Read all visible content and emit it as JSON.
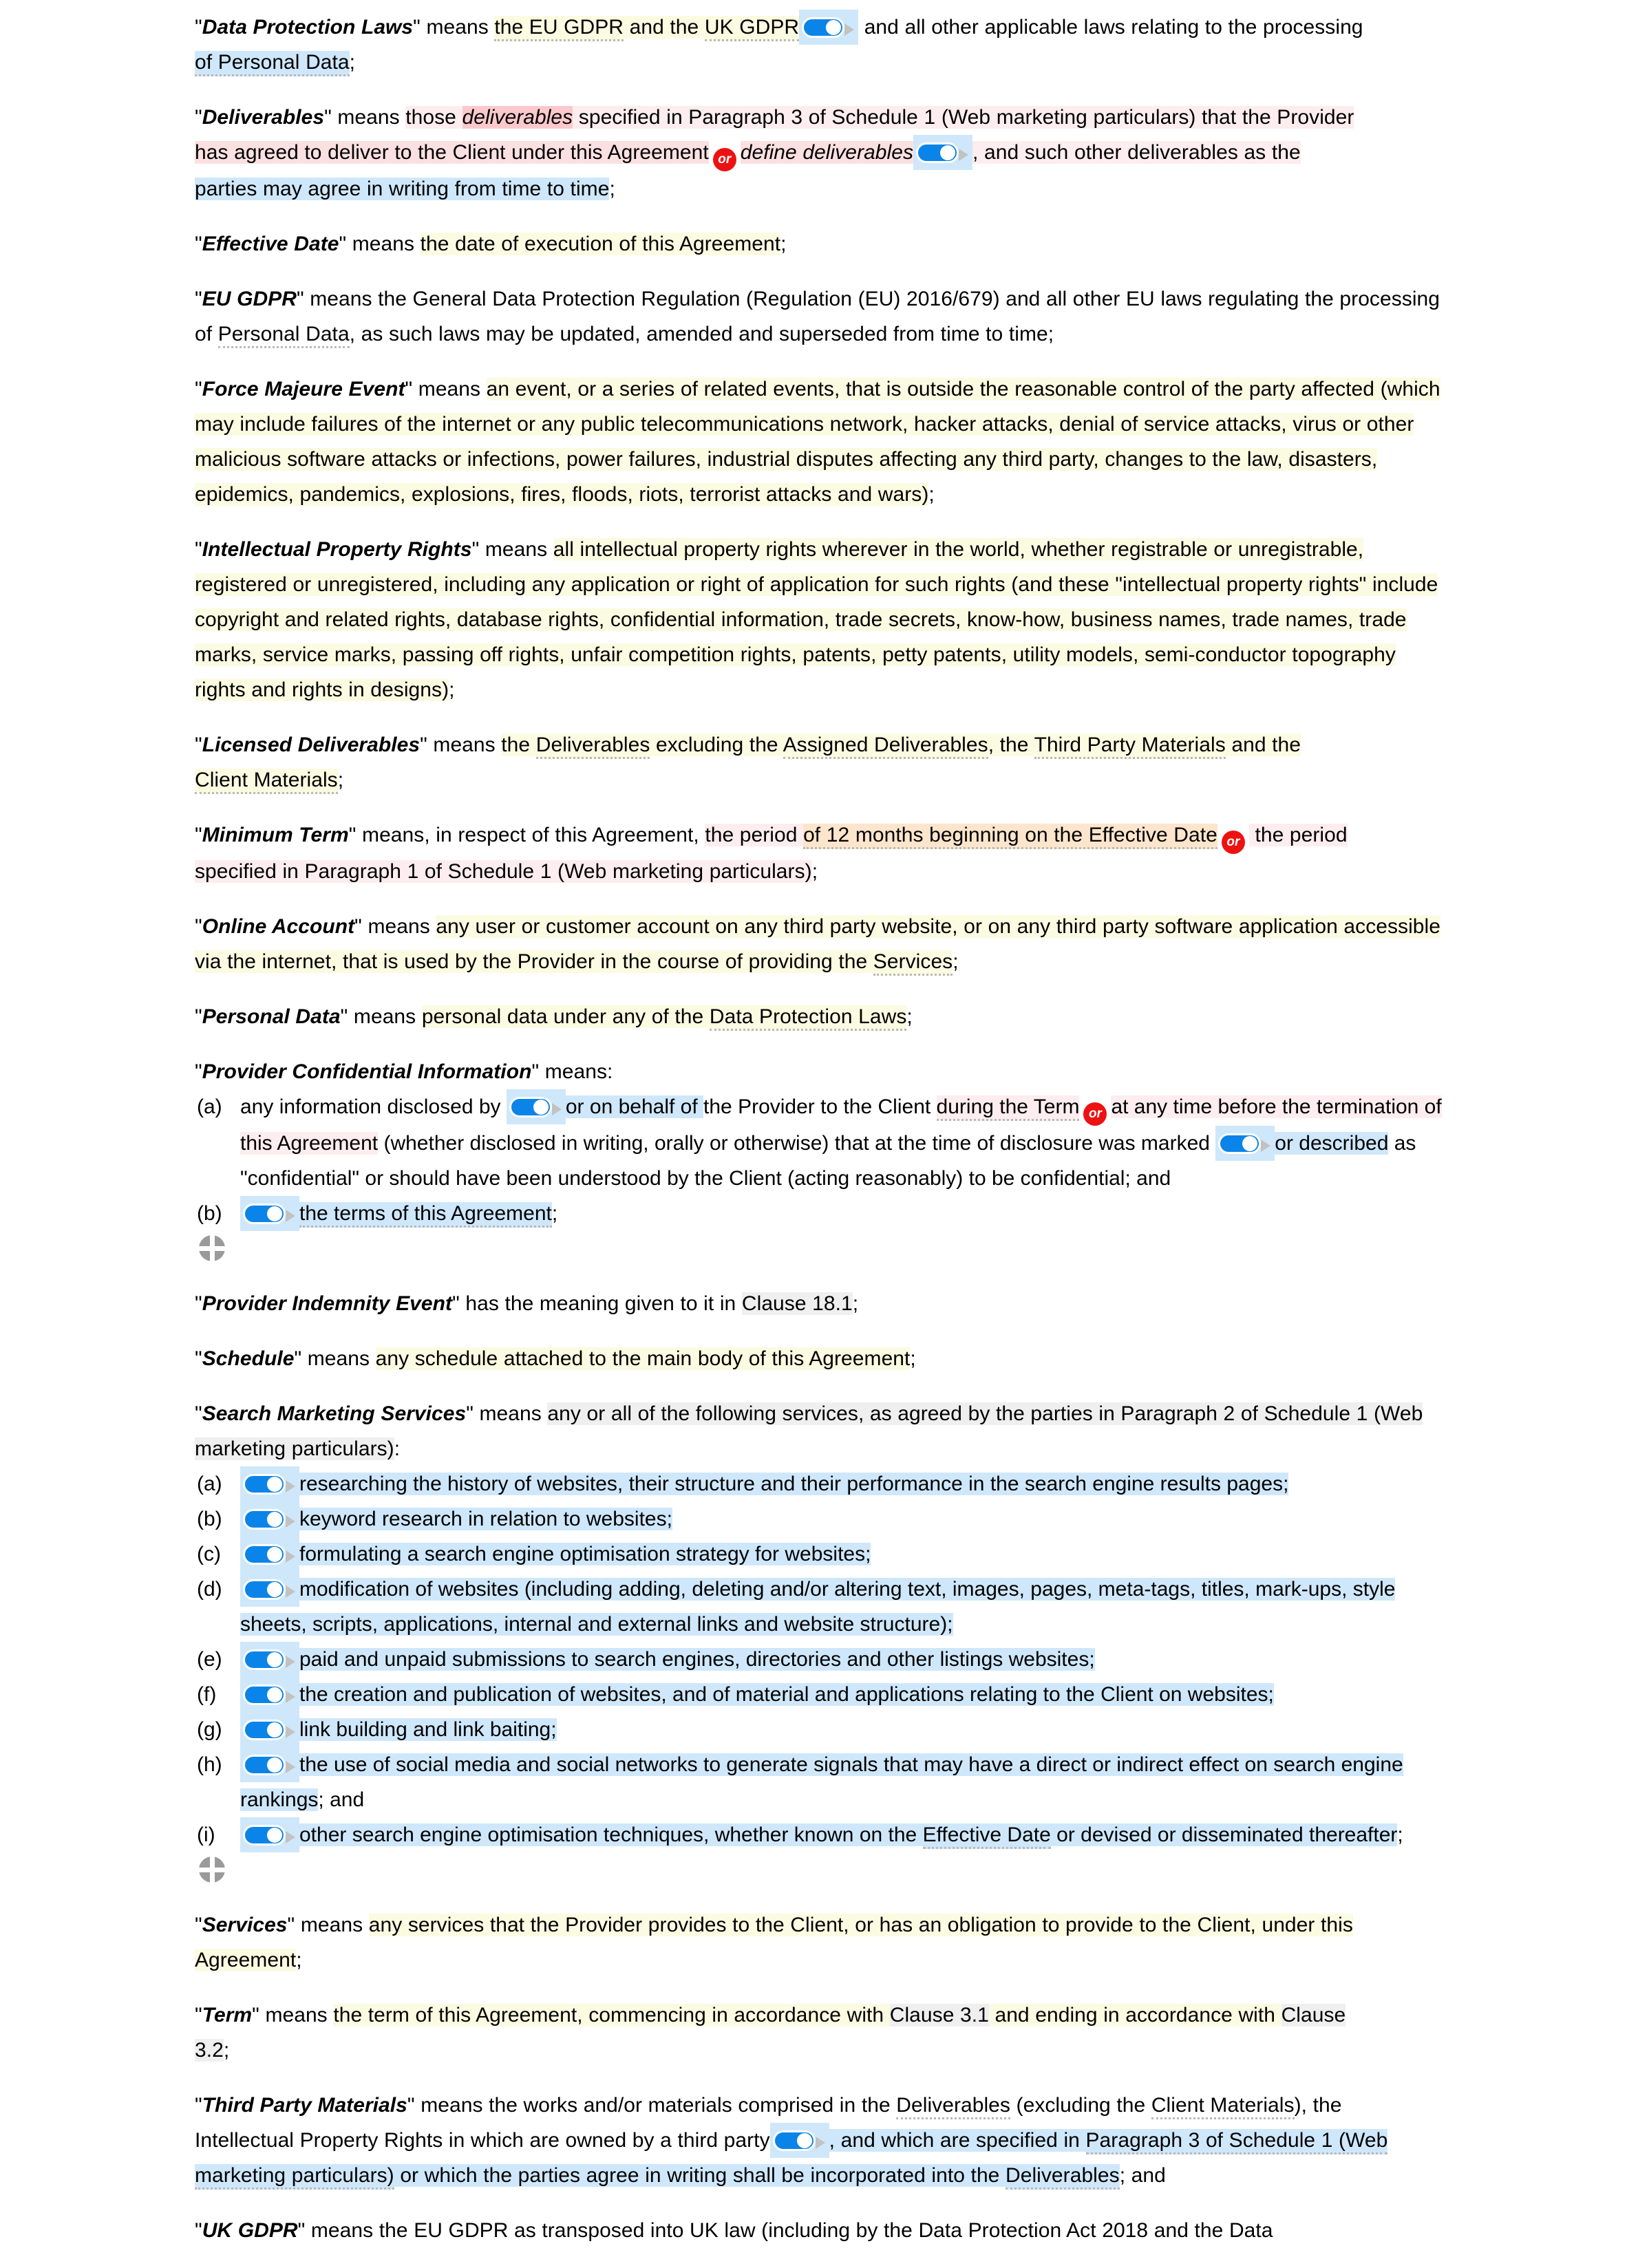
{
  "document": {
    "type": "legal-contract-definitions",
    "icons": {
      "or_badge": "or-badge-icon",
      "toggle": "toggle-switch-icon",
      "move_handle": "move-crosshair-icon"
    },
    "colors": {
      "or_badge_bg": "#ee1111",
      "or_badge_text": "#ffffff",
      "toggle_on": "#0a84e8",
      "toggle_knob": "#ffffff",
      "toggle_arrow": "#c2c2c2",
      "move_handle": "#9a9a9a",
      "highlight_yellow": "#fbfbe2",
      "highlight_blue": "#cfe7fa",
      "highlight_pink": "#fbe0e2",
      "highlight_pink_strong": "#fbc9cc",
      "highlight_pink_light": "#fdedee",
      "highlight_peach": "#fde5cc",
      "highlight_grey": "#efefef",
      "text": "#000000"
    },
    "labels": {
      "or": "or"
    }
  },
  "definitions": {
    "data_protection_laws": {
      "term": "Data Protection Laws",
      "p1": "\" means ",
      "s_eu_gdpr": "the EU GDPR",
      "s_and_the": " and the ",
      "s_uk_gdpr": "UK GDPR",
      "s_rest": " and all other applicable laws relating to the processing",
      "s_line2": "of Personal Data",
      "s_end": ";"
    },
    "deliverables": {
      "term": "Deliverables",
      "p1": "\" means ",
      "s_those": "those ",
      "s_deliverables_italic": "deliverables",
      "s_specified": " specified in Paragraph 3 of Schedule 1 (Web marketing particulars) that the Provider",
      "s_line2": "has agreed to deliver to the Client under this Agreement",
      "s_define_italic": "define deliverables",
      "s_after": ", and such other deliverables as the",
      "s_line3": "parties may agree in writing from time to time",
      "s_end": ";"
    },
    "effective_date": {
      "term": "Effective Date",
      "p1": "\" means ",
      "s_body": "the date of execution of this Agreement",
      "s_end": ";"
    },
    "eu_gdpr": {
      "term": "EU GDPR",
      "p1": "\" means the General Data Protection Regulation (Regulation (EU) 2016/679) and all other EU laws regulating the",
      "p2": "processing of ",
      "s_personal_data": "Personal Data",
      "p3": ", as such laws may be updated, amended and superseded from time to time;"
    },
    "force_majeure": {
      "term": "Force Majeure Event",
      "p1": "\" means ",
      "s_body": "an event, or a series of related events, that is outside the reasonable control of the party affected (which may include failures of the internet or any public telecommunications network, hacker attacks, denial of service attacks, virus or other malicious software attacks or infections, power failures, industrial disputes affecting any third party, changes to the law, disasters, epidemics, pandemics, explosions, fires, floods, riots, terrorist attacks and wars)",
      "s_end": ";"
    },
    "ip_rights": {
      "term": "Intellectual Property Rights",
      "p1": "\" means ",
      "s_body": "all intellectual property rights wherever in the world, whether registrable or unregistrable, registered or unregistered, including any application or right of application for such rights (and these \"intellectual property rights\" include copyright and related rights, database rights, confidential information, trade secrets, know-how, business names, trade names, trade marks, service marks, passing off rights, unfair competition rights, patents, petty patents, utility models, semi-conductor topography rights and rights in designs)",
      "s_end": ";"
    },
    "licensed_deliverables": {
      "term": "Licensed Deliverables",
      "p1": "\" means ",
      "s_a": "the ",
      "s_deliverables": "Deliverables",
      "s_b": " excluding the ",
      "s_assigned": "Assigned Deliverables",
      "s_c": ", the ",
      "s_third_party": "Third Party Materials",
      "s_d": " and the",
      "s_line2": "Client Materials",
      "s_end": ";"
    },
    "minimum_term": {
      "term": "Minimum Term",
      "p1": "\" means, in respect of this Agreement, ",
      "s_period": "the period ",
      "s_12months": "of 12 months beginning on the Effective Date",
      "s_after_or": " the period",
      "s_line2": "specified in Paragraph 1 of Schedule 1 (Web marketing particulars)",
      "s_end": ";"
    },
    "online_account": {
      "term": "Online Account",
      "p1": "\" means ",
      "s_body": "any user or customer account on any third party website, or on any third party software application accessible via the internet, that is used by the Provider in the course of providing the ",
      "s_services": "Services",
      "s_end": ";"
    },
    "personal_data": {
      "term": "Personal Data",
      "p1": "\" means ",
      "s_body": "personal data under any of the ",
      "s_dpl": "Data Protection Laws",
      "s_end": ";"
    },
    "provider_confidential": {
      "term": "Provider Confidential Information",
      "p1": "\" means:",
      "items": [
        {
          "marker": "(a)",
          "pre": "any information disclosed by ",
          "mid1": "or on behalf of ",
          "mid2": "the Provider to the Client ",
          "during_term": "during the Term",
          "after_or": "at any time before the termination of this Agreement",
          "tail1": " (whether disclosed in writing, orally or otherwise) that at the time of disclosure was marked ",
          "described": "or described",
          "tail2": " as \"confidential\" or should have been understood by the Client (acting reasonably) to be confidential; and"
        },
        {
          "marker": "(b)",
          "text": "the terms of this Agreement",
          "end": ";"
        }
      ]
    },
    "provider_indemnity": {
      "term": "Provider Indemnity Event",
      "p1": "\" has the meaning given to it in ",
      "s_clause": "Clause 18.1",
      "s_end": ";"
    },
    "schedule": {
      "term": "Schedule",
      "p1": "\" means ",
      "s_body": "any schedule attached to the main body of this Agreement",
      "s_end": ";"
    },
    "search_marketing": {
      "term": "Search Marketing Services",
      "p1": "\" means ",
      "s_body": "any or all of the following services, as agreed by the parties in ",
      "s_para": "Paragraph 2 of Schedule 1 (Web marketing particulars)",
      "s_end": ":",
      "items": [
        {
          "marker": "(a)",
          "text": "researching the history of websites, their structure and their performance in the search engine results pages;"
        },
        {
          "marker": "(b)",
          "text": "keyword research in relation to websites;"
        },
        {
          "marker": "(c)",
          "text": "formulating a search engine optimisation strategy for websites;"
        },
        {
          "marker": "(d)",
          "text": "modification of websites (including adding, deleting and/or altering text, images, pages, meta-tags, titles, mark-ups, style sheets, scripts, applications, internal and external links and website structure);"
        },
        {
          "marker": "(e)",
          "text": "paid and unpaid submissions to search engines, directories and other listings websites;"
        },
        {
          "marker": "(f)",
          "text": "the creation and publication of websites, and of material and applications relating to the Client on websites;"
        },
        {
          "marker": "(g)",
          "text": "link building and link baiting;"
        },
        {
          "marker": "(h)",
          "text": "the use of social media and social networks to generate signals that may have a direct or indirect effect on search engine rankings",
          "tail": "; and"
        },
        {
          "marker": "(i)",
          "text_a": "other search engine optimisation techniques, whether known on the ",
          "text_eff": "Effective Date",
          "text_b": " or devised or disseminated thereafter",
          "tail": ";"
        }
      ]
    },
    "services": {
      "term": "Services",
      "p1": "\" means ",
      "s_body": "any services that the Provider provides to the Client, or has an obligation to provide to the Client, under this Agreement",
      "s_end": ";"
    },
    "term_def": {
      "term": "Term",
      "p1": "\" means ",
      "s_a": "the term of this Agreement, commencing in accordance with ",
      "s_clause31": "Clause 3.1",
      "s_b": " and ending in accordance with ",
      "s_clause32a": "Clause",
      "s_clause32b": "3.2",
      "s_end": ";"
    },
    "third_party_materials": {
      "term": "Third Party Materials",
      "p1": "\" means the works and/or materials comprised in the ",
      "s_deliv": "Deliverables",
      "p2": " (excluding the ",
      "s_client_mat": "Client Materials",
      "p3": "), the",
      "line2": "Intellectual Property Rights in which are owned by a third party",
      "s_after_toggle": ", and which are specified in ",
      "s_para3": "Paragraph 3 of Schedule 1 (Web marketing particulars)",
      "s_or_which": " or which the parties agree in writing shall be incorporated into the ",
      "s_deliverables2": "Deliverables",
      "s_end": "; and"
    },
    "uk_gdpr": {
      "term": "UK GDPR",
      "p1": "\" means the EU GDPR as transposed into UK law (including by the Data Protection Act 2018 and the Data"
    }
  }
}
